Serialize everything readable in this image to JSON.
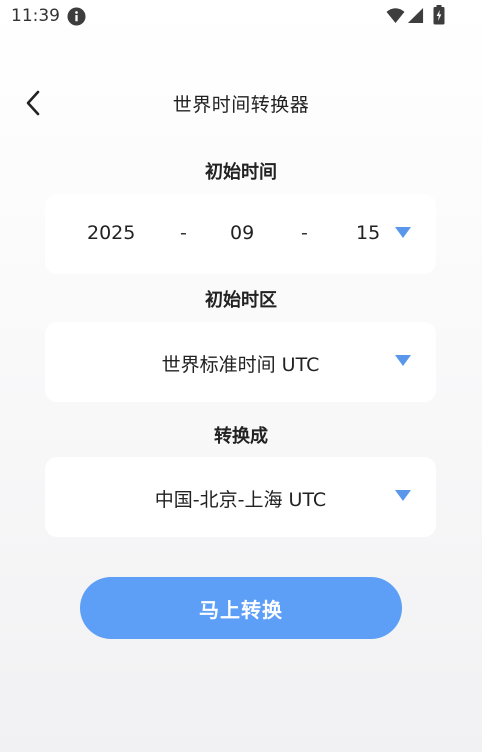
{
  "status_bar": {
    "time": "11:39"
  },
  "header": {
    "title": "世界时间转换器"
  },
  "start_date": {
    "label": "初始时间",
    "year": "2025",
    "separator": "-",
    "month": "09",
    "day": "15"
  },
  "start_timezone": {
    "label": "初始时区",
    "value": "世界标准时间 UTC"
  },
  "target_timezone": {
    "label": "转换成",
    "value": "中国-北京-上海 UTC"
  },
  "convert_button": {
    "label": "马上转换"
  },
  "colors": {
    "accent": "#5d9ef7",
    "dropdown_arrow": "#5a97ea",
    "card": "#ffffff"
  },
  "icons": [
    "info-icon",
    "wifi-icon",
    "signal-icon",
    "battery-icon",
    "back-arrow-icon",
    "dropdown-arrow-icon"
  ]
}
